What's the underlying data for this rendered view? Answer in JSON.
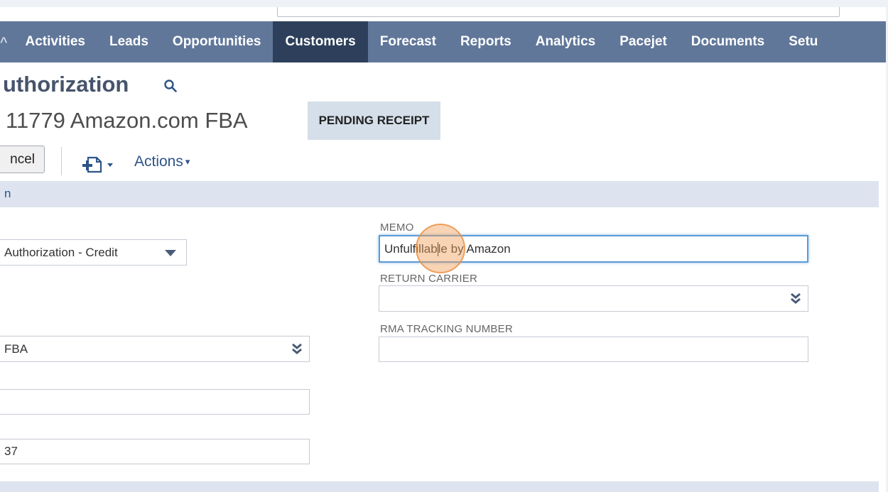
{
  "nav": {
    "items": [
      {
        "label": "Activities",
        "active": false
      },
      {
        "label": "Leads",
        "active": false
      },
      {
        "label": "Opportunities",
        "active": false
      },
      {
        "label": "Customers",
        "active": true
      },
      {
        "label": "Forecast",
        "active": false
      },
      {
        "label": "Reports",
        "active": false
      },
      {
        "label": "Analytics",
        "active": false
      },
      {
        "label": "Pacejet",
        "active": false
      },
      {
        "label": "Documents",
        "active": false
      },
      {
        "label": "Setu",
        "active": false
      }
    ],
    "prev_glyph": "^",
    "bar_color": "#607799",
    "active_color": "#2d3f5b"
  },
  "header": {
    "title": "uthorization",
    "record_name": "11779 Amazon.com FBA",
    "status": "PENDING RECEIPT"
  },
  "toolbar": {
    "cancel_label": "ncel",
    "actions_label": "Actions",
    "actions_caret": "▾"
  },
  "section": {
    "title": "n"
  },
  "form": {
    "custom_form_value": "Authorization - Credit",
    "customer_value": "FBA",
    "blank_field_value": "",
    "field_37_value": "37",
    "memo_label": "MEMO",
    "memo_value_before_cursor": "Unfulfillab",
    "memo_value_after_cursor": "le by Amazon",
    "return_carrier_label": "RETURN CARRIER",
    "return_carrier_value": "",
    "rma_label": "RMA TRACKING NUMBER",
    "rma_value": ""
  },
  "colors": {
    "accent": "#2d5488",
    "focus": "#5b9bd5",
    "badge_bg": "#d5dfe9",
    "section_bg": "#dde4ef"
  },
  "icons": [
    "search-icon",
    "new-document-icon",
    "chevron-down-icon",
    "double-chevron-down-icon",
    "caret-down-icon"
  ]
}
